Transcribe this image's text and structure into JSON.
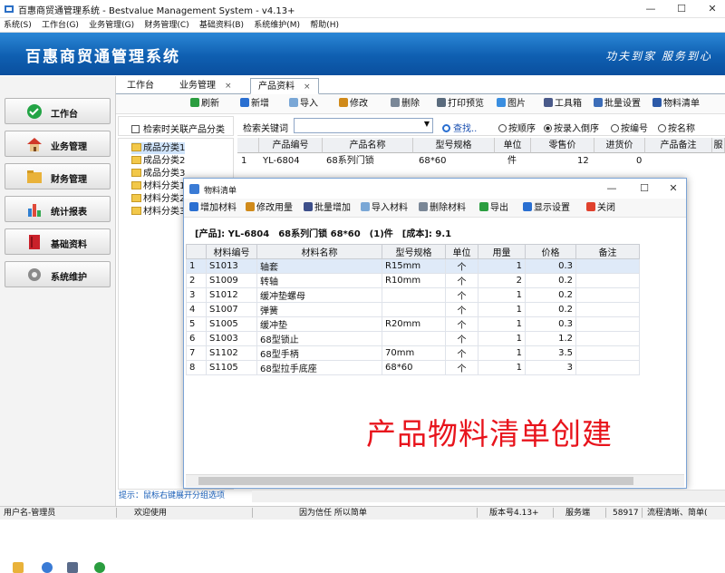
{
  "window": {
    "title": "百惠商贸通管理系统 - Bestvalue Management System - v4.13+",
    "min_icon": "minimize-icon",
    "max_icon": "maximize-icon",
    "close_icon": "close-icon",
    "min": "—",
    "max": "☐",
    "close": "✕"
  },
  "menu": [
    "系统(S)",
    "工作台(G)",
    "业务管理(G)",
    "财务管理(C)",
    "基础资料(B)",
    "系统维护(M)",
    "帮助(H)"
  ],
  "banner": {
    "title": "百惠商贸通管理系统",
    "slogan": "功夫到家 服务到心"
  },
  "sidebar": [
    {
      "label": "工作台",
      "icon": "check-circle-icon",
      "color": "#23a445"
    },
    {
      "label": "业务管理",
      "icon": "house-icon",
      "color": "#d0392a"
    },
    {
      "label": "财务管理",
      "icon": "folder-icon",
      "color": "#e9b23a"
    },
    {
      "label": "统计报表",
      "icon": "bar-chart-icon",
      "color": "#2f7fd1"
    },
    {
      "label": "基础资料",
      "icon": "book-icon",
      "color": "#c9212a"
    },
    {
      "label": "系统维护",
      "icon": "gear-icon",
      "color": "#8a8a8a"
    }
  ],
  "tabs": [
    {
      "label": "工作台"
    },
    {
      "label": "业务管理",
      "x": "×"
    },
    {
      "label": "产品资料",
      "x": "×"
    }
  ],
  "toolbar": [
    {
      "label": "刷新",
      "color": "#2a9d3f"
    },
    {
      "label": "新增",
      "color": "#2a6fd1"
    },
    {
      "label": "导入",
      "color": "#7aa7d6"
    },
    {
      "label": "修改",
      "color": "#d08a1a"
    },
    {
      "label": "删除",
      "color": "#7a8797"
    },
    {
      "label": "打印预览",
      "color": "#5a6b7d"
    },
    {
      "label": "图片",
      "color": "#3a8ee0"
    },
    {
      "label": "工具箱",
      "color": "#4a5a8a"
    },
    {
      "label": "批量设置",
      "color": "#3c6db8"
    },
    {
      "label": "物料清单",
      "color": "#2c5aa8"
    }
  ],
  "left": {
    "filter_checkbox": "检索时关联产品分类",
    "tree": [
      "成品分类1",
      "成品分类2",
      "成品分类3",
      "材料分类1",
      "材料分类2",
      "材料分类3"
    ]
  },
  "search": {
    "label": "检索关键词",
    "value": "",
    "find": "查找..",
    "options": [
      "按顺序",
      "按录入倒序",
      "按编号",
      "按名称"
    ],
    "selected": 1
  },
  "grid": {
    "columns": [
      "产品编号",
      "产品名称",
      "型号规格",
      "单位",
      "零售价",
      "进货价",
      "产品备注",
      "服"
    ],
    "rows": [
      [
        "1",
        "YL-6804",
        "68系列门锁",
        "68*60",
        "件",
        "12",
        "0"
      ]
    ]
  },
  "bom": {
    "title": "物料清单",
    "toolbar": [
      {
        "label": "增加材料",
        "color": "#2a6fd1"
      },
      {
        "label": "修改用量",
        "color": "#d08a1a"
      },
      {
        "label": "批量增加",
        "color": "#3d4f8a"
      },
      {
        "label": "导入材料",
        "color": "#7aa7d6"
      },
      {
        "label": "删除材料",
        "color": "#7a8797"
      },
      {
        "label": "导出",
        "color": "#2a9d3f"
      },
      {
        "label": "显示设置",
        "color": "#2a6fd1"
      },
      {
        "label": "关闭",
        "color": "#e0412d"
      }
    ],
    "summary": "[产品]: YL-6804　68系列门锁  68*60　(1)件　[成本]: 9.1",
    "columns": [
      "材料编号",
      "材料名称",
      "型号规格",
      "单位",
      "用量",
      "价格",
      "备注"
    ],
    "rows": [
      [
        "1",
        "S1013",
        "轴套",
        "R15mm",
        "个",
        "1",
        "0.3",
        ""
      ],
      [
        "2",
        "S1009",
        "转轴",
        "R10mm",
        "个",
        "2",
        "0.2",
        ""
      ],
      [
        "3",
        "S1012",
        "缓冲垫螺母",
        "",
        "个",
        "1",
        "0.2",
        ""
      ],
      [
        "4",
        "S1007",
        "弹簧",
        "",
        "个",
        "1",
        "0.2",
        ""
      ],
      [
        "5",
        "S1005",
        "缓冲垫",
        "R20mm",
        "个",
        "1",
        "0.3",
        ""
      ],
      [
        "6",
        "S1003",
        "68型锁止",
        "",
        "个",
        "1",
        "1.2",
        ""
      ],
      [
        "7",
        "S1102",
        "68型手柄",
        "70mm",
        "个",
        "1",
        "3.5",
        ""
      ],
      [
        "8",
        "S1105",
        "68型拉手底座",
        "68*60",
        "个",
        "1",
        "3",
        ""
      ]
    ]
  },
  "overlay_text": "产品物料清单创建",
  "hint": "提示：鼠标右键展开分组选项",
  "status": [
    "用户名-管理员",
    "欢迎使用",
    "因为信任 所以简单",
    "版本号4.13+",
    "服务端",
    "58917",
    "流程清晰、简单("
  ]
}
